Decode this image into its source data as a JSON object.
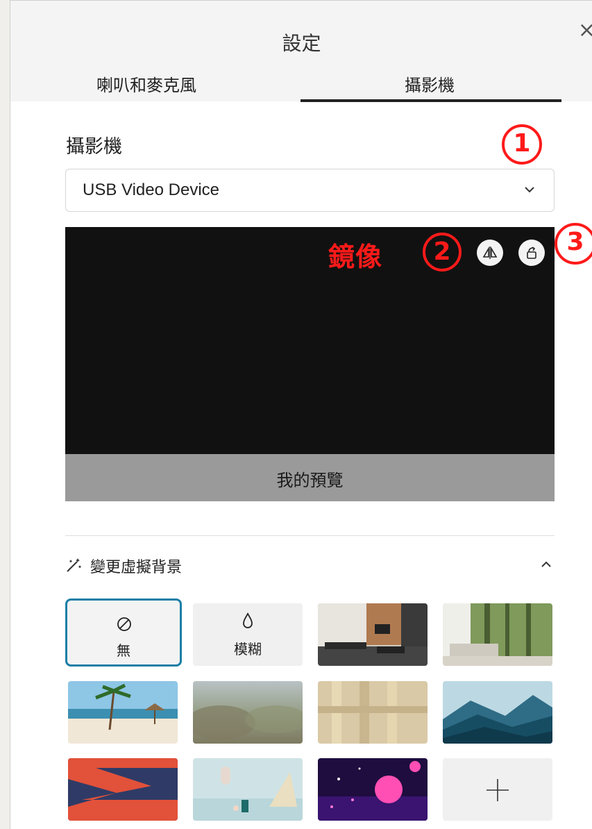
{
  "dialog": {
    "title": "設定",
    "close_glyph": "×"
  },
  "tabs": [
    {
      "label": "喇叭和麥克風",
      "selected": false
    },
    {
      "label": "攝影機",
      "selected": true
    }
  ],
  "camera": {
    "section_label": "攝影機",
    "device_value": "USB Video Device",
    "chevron_icon": "chevron-down-icon"
  },
  "preview": {
    "label": "我的預覽",
    "mirror_icon": "mirror-icon",
    "rotate_icon": "rotate-icon"
  },
  "annotations": {
    "color": "#ff1a1a",
    "mirror_text": "鏡像",
    "num1": "1",
    "num2": "2",
    "num3": "3"
  },
  "background": {
    "title": "變更虛擬背景",
    "icon": "magic-wand-icon",
    "chevron_icon": "chevron-up-icon",
    "options": [
      {
        "label": "無",
        "icon": "none-icon",
        "selected": true
      },
      {
        "label": "模糊",
        "icon": "blur-drop-icon",
        "selected": false
      },
      {
        "label": "",
        "icon": "office-image"
      },
      {
        "label": "",
        "icon": "living-room-forest-image"
      },
      {
        "label": "",
        "icon": "beach-image"
      },
      {
        "label": "",
        "icon": "blurred-landscape-image"
      },
      {
        "label": "",
        "icon": "shadow-wall-image"
      },
      {
        "label": "",
        "icon": "mountains-image"
      },
      {
        "label": "",
        "icon": "abstract-red-blue-image"
      },
      {
        "label": "",
        "icon": "pastel-stairs-image"
      },
      {
        "label": "",
        "icon": "neon-space-image"
      },
      {
        "label": "",
        "icon": "add-icon"
      }
    ]
  },
  "colors": {
    "accent": "#1a7fa6",
    "preview_bg": "#111111",
    "preview_bar": "#9a9a9a"
  }
}
